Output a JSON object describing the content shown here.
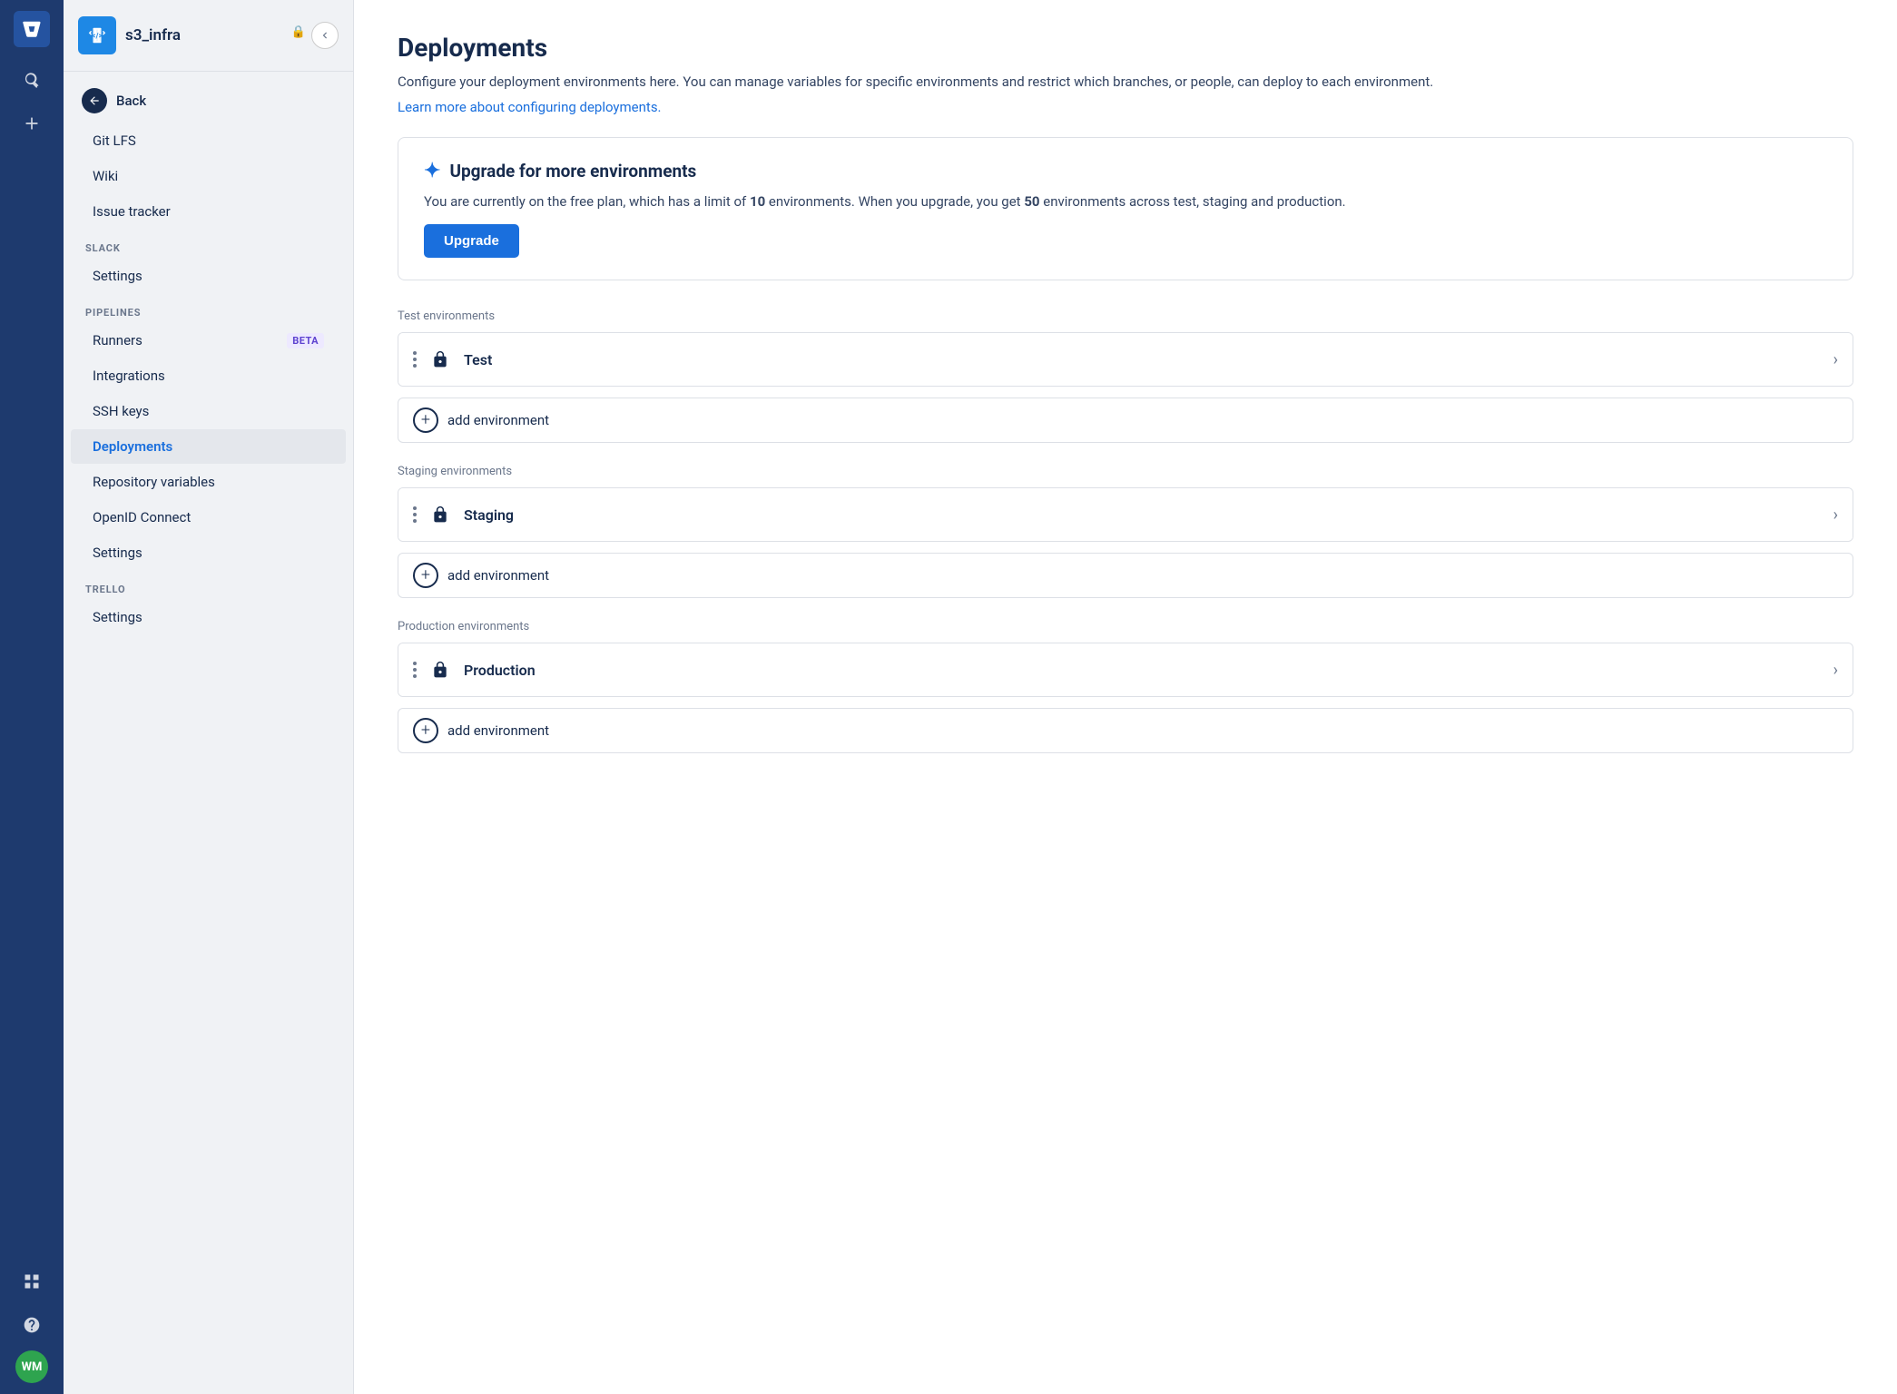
{
  "iconBar": {
    "logo": "bitbucket-logo",
    "search_label": "Search",
    "create_label": "Create",
    "grid_label": "Apps",
    "help_label": "Help",
    "avatar_initials": "WM"
  },
  "sidebar": {
    "repo_name": "s3_infra",
    "back_label": "Back",
    "nav_items_top": [
      {
        "label": "Git LFS",
        "id": "git-lfs"
      },
      {
        "label": "Wiki",
        "id": "wiki"
      },
      {
        "label": "Issue tracker",
        "id": "issue-tracker"
      }
    ],
    "sections": [
      {
        "label": "SLACK",
        "items": [
          {
            "label": "Settings",
            "id": "slack-settings"
          }
        ]
      },
      {
        "label": "PIPELINES",
        "items": [
          {
            "label": "Runners",
            "id": "runners",
            "badge": "BETA"
          },
          {
            "label": "Integrations",
            "id": "integrations"
          },
          {
            "label": "SSH keys",
            "id": "ssh-keys"
          },
          {
            "label": "Deployments",
            "id": "deployments",
            "active": true
          },
          {
            "label": "Repository variables",
            "id": "repo-vars"
          },
          {
            "label": "OpenID Connect",
            "id": "openid"
          },
          {
            "label": "Settings",
            "id": "pipeline-settings"
          }
        ]
      },
      {
        "label": "TRELLO",
        "items": [
          {
            "label": "Settings",
            "id": "trello-settings"
          }
        ]
      }
    ]
  },
  "main": {
    "title": "Deployments",
    "description": "Configure your deployment environments here. You can manage variables for specific environments and restrict which branches, or people, can deploy to each environment.",
    "link_text": "Learn more about configuring deployments.",
    "upgrade_banner": {
      "title": "Upgrade for more environments",
      "description_prefix": "You are currently on the free plan, which has a limit of ",
      "current_limit": "10",
      "description_middle": " environments. When you upgrade, you get ",
      "upgrade_limit": "50",
      "description_suffix": " environments across test, staging and production.",
      "button_label": "Upgrade"
    },
    "env_groups": [
      {
        "label": "Test environments",
        "items": [
          {
            "name": "Test",
            "id": "test"
          }
        ],
        "add_label": "add environment"
      },
      {
        "label": "Staging environments",
        "items": [
          {
            "name": "Staging",
            "id": "staging"
          }
        ],
        "add_label": "add environment"
      },
      {
        "label": "Production environments",
        "items": [
          {
            "name": "Production",
            "id": "production"
          }
        ],
        "add_label": "add environment"
      }
    ]
  }
}
